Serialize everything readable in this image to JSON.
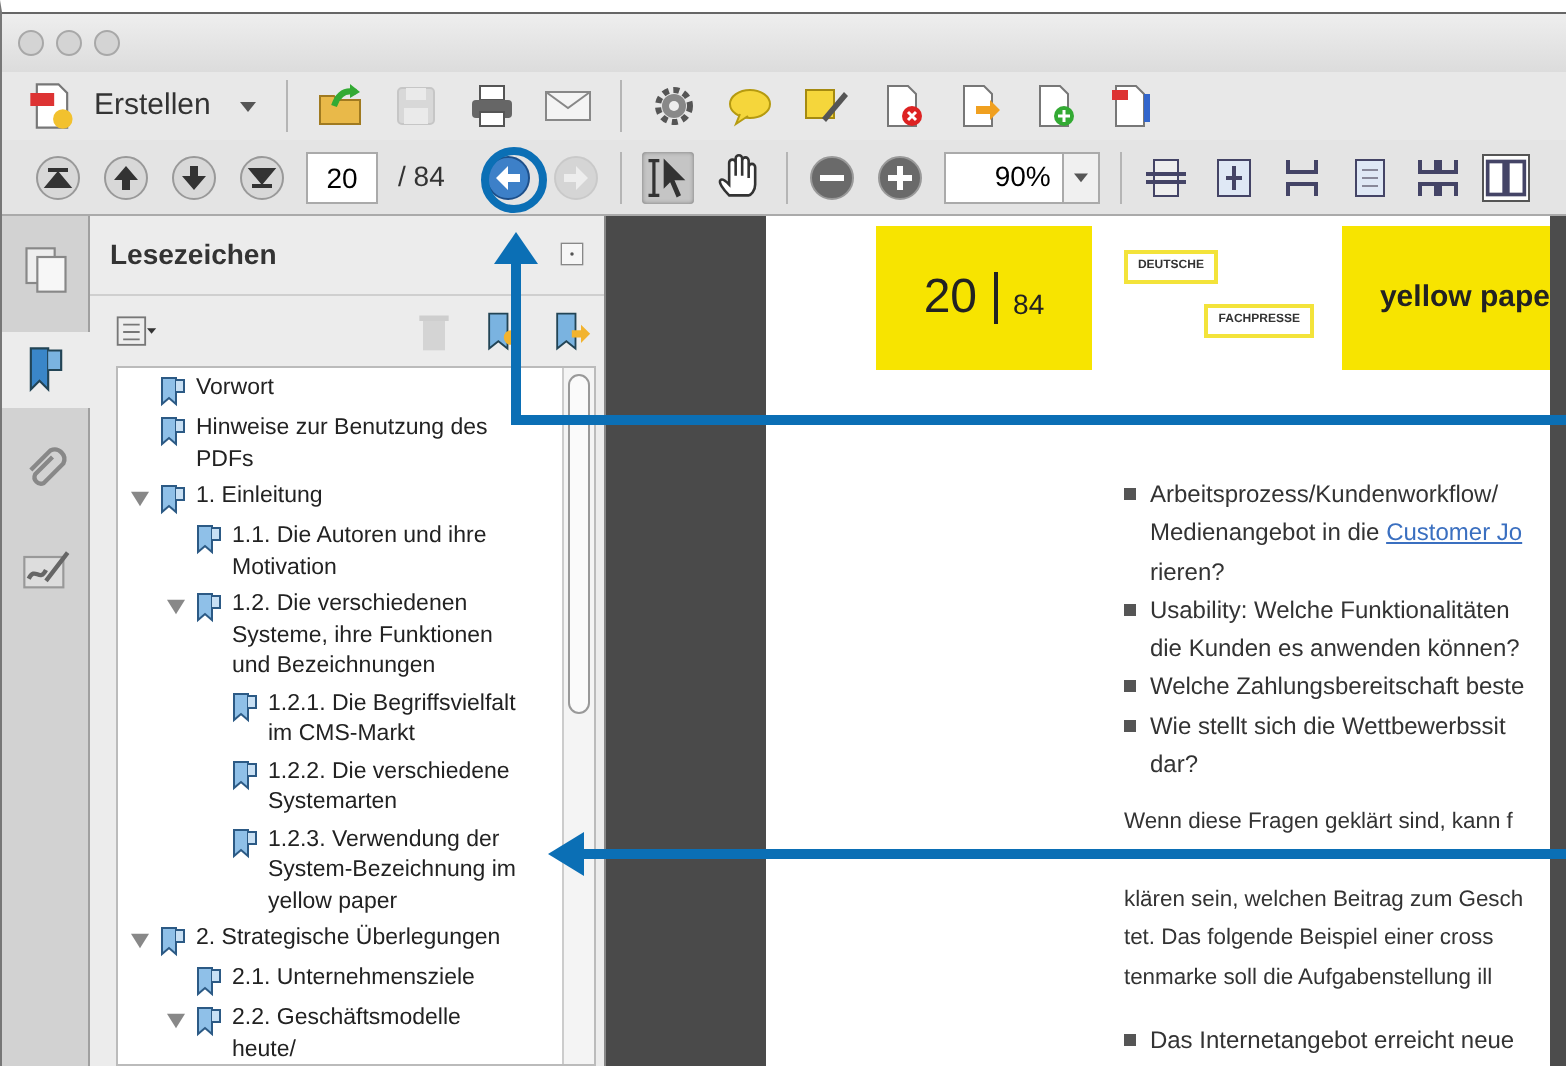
{
  "toolbar": {
    "create_label": "Erstellen",
    "tool_groups": [
      [
        {
          "kind": "open",
          "disabled": false
        },
        {
          "kind": "save",
          "disabled": true
        },
        {
          "kind": "print",
          "disabled": false
        },
        {
          "kind": "email",
          "disabled": false
        }
      ],
      [
        {
          "kind": "settings",
          "disabled": false
        },
        {
          "kind": "comment",
          "disabled": false
        },
        {
          "kind": "sign",
          "disabled": false
        },
        {
          "kind": "delete",
          "disabled": false
        },
        {
          "kind": "export",
          "disabled": false
        },
        {
          "kind": "combine",
          "disabled": false
        },
        {
          "kind": "form",
          "disabled": false
        }
      ]
    ]
  },
  "navigation": {
    "page_buttons": [
      {
        "kind": "first"
      },
      {
        "kind": "previous"
      },
      {
        "kind": "next"
      },
      {
        "kind": "last"
      }
    ],
    "page": "20",
    "page_count": "/ 84",
    "history": [
      {
        "kind": "back",
        "disabled": false
      },
      {
        "kind": "forward",
        "disabled": true
      }
    ],
    "tools": [
      {
        "kind": "select",
        "selected": true
      },
      {
        "kind": "hand",
        "selected": false
      }
    ],
    "zoom_buttons": [
      {
        "kind": "zoom-out"
      },
      {
        "kind": "zoom-in"
      }
    ],
    "zoom": "90%",
    "views": [
      {
        "kind": "fit-width",
        "selected": false
      },
      {
        "kind": "fit-page",
        "selected": false
      },
      {
        "kind": "scrolling",
        "selected": false
      },
      {
        "kind": "single-page",
        "selected": false
      },
      {
        "kind": "two-page-scrolling",
        "selected": false
      },
      {
        "kind": "two-page",
        "selected": true
      }
    ]
  },
  "sidebar": {
    "tabs": [
      {
        "kind": "pages",
        "selected": false
      },
      {
        "kind": "bookmarks",
        "selected": true
      },
      {
        "kind": "attachments",
        "selected": false
      },
      {
        "kind": "signatures",
        "selected": false
      }
    ],
    "panel_title": "Lesezeichen",
    "panel_tools": [
      {
        "kind": "options",
        "disabled": false
      },
      {
        "kind": "delete",
        "disabled": true
      },
      {
        "kind": "new-bookmark",
        "disabled": false
      },
      {
        "kind": "expand-bookmark",
        "disabled": false
      }
    ],
    "bookmarks": [
      {
        "label": "Vorwort"
      },
      {
        "label": "Hinweise zur Benutzung des PDFs"
      },
      {
        "label": "1. Einleitung",
        "expanded": true,
        "children": [
          {
            "label": "1.1. Die Autoren und ihre Motivation"
          },
          {
            "label": "1.2. Die verschiedenen Systeme, ihre Funktionen und Bezeichnungen",
            "expanded": true,
            "children": [
              {
                "label": "1.2.1. Die Begriffsvielfalt im CMS-Markt"
              },
              {
                "label": "1.2.2. Die verschiedene Systemarten"
              },
              {
                "label": "1.2.3. Verwendung der System-Bezeichnung im yellow paper"
              }
            ]
          }
        ]
      },
      {
        "label": "2. Strategische Überlegungen",
        "expanded": true,
        "children": [
          {
            "label": "2.1. Unternehmensziele"
          },
          {
            "label": "2.2. Geschäftsmodelle heute/",
            "expanded": true
          }
        ]
      }
    ]
  },
  "document": {
    "page_number": "20",
    "page_total": "84",
    "logo": [
      "DEUTSCHE",
      "FACHPRESSE"
    ],
    "header_title": "yellow pape",
    "blocks": [
      {
        "kind": "bullet",
        "lines": [
          {
            "text": "Arbeitsprozess/Kundenworkflow/"
          },
          {
            "text": "Medienangebot in die ",
            "link": "Customer Jo"
          },
          {
            "text": "rieren?"
          }
        ]
      },
      {
        "kind": "bullet",
        "lines": [
          {
            "text": "Usability: Welche Funktionalitäten"
          },
          {
            "text": "die Kunden es anwenden können?"
          }
        ]
      },
      {
        "kind": "bullet",
        "lines": [
          {
            "text": "Welche Zahlungsbereitschaft beste"
          }
        ]
      },
      {
        "kind": "bullet",
        "lines": [
          {
            "text": "Wie stellt sich die Wettbewerbssit"
          },
          {
            "text": "dar?"
          }
        ]
      },
      {
        "kind": "paragraph",
        "lines": [
          {
            "text": "Wenn diese Fragen geklärt sind, kann f"
          },
          {
            "text": "klären sein, welchen Beitrag zum Gesch"
          },
          {
            "text": "tet. Das folgende Beispiel einer cross"
          },
          {
            "text": "tenmarke soll die Aufgabenstellung ill"
          }
        ]
      },
      {
        "kind": "bullet",
        "lines": [
          {
            "text": "Das Internetangebot erreicht neue"
          }
        ]
      }
    ]
  }
}
